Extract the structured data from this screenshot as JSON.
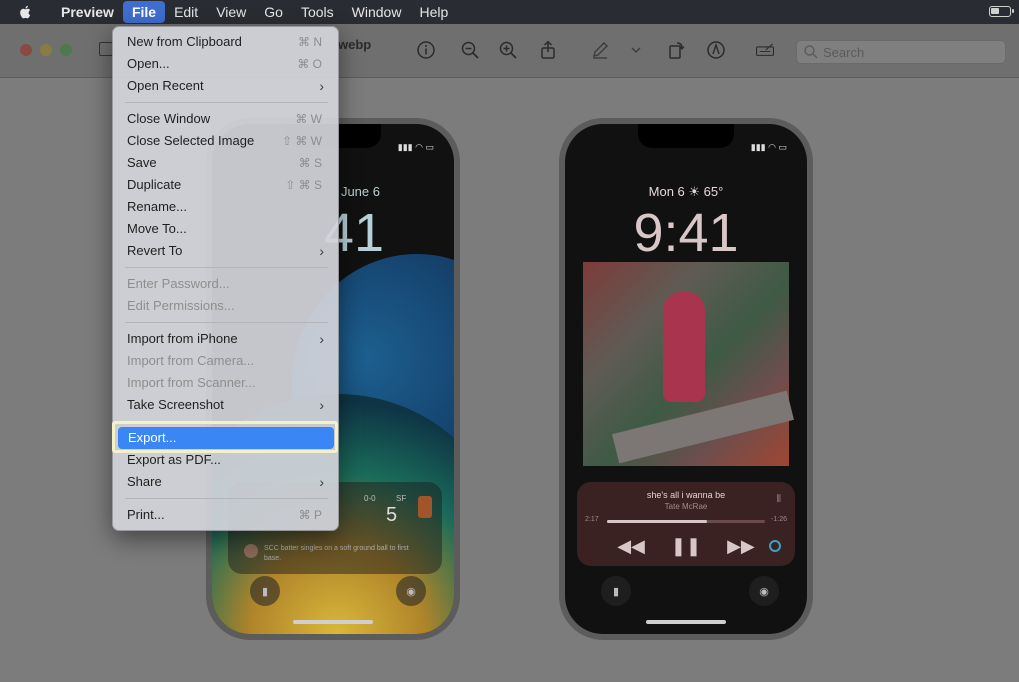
{
  "menubar": {
    "apple_icon": "apple-icon",
    "app": "Preview",
    "items": [
      "File",
      "Edit",
      "View",
      "Go",
      "Tools",
      "Window",
      "Help"
    ],
    "active": "File"
  },
  "window": {
    "title": "webp",
    "search_placeholder": "Search"
  },
  "file_menu": {
    "items": [
      {
        "label": "New from Clipboard",
        "shortcut": "⌘ N"
      },
      {
        "label": "Open...",
        "shortcut": "⌘ O"
      },
      {
        "label": "Open Recent",
        "submenu": "›"
      },
      {
        "label": "Close Window",
        "shortcut": "⌘ W"
      },
      {
        "label": "Close Selected Image",
        "shortcut": "⇧ ⌘ W"
      },
      {
        "label": "Save",
        "shortcut": "⌘ S"
      },
      {
        "label": "Duplicate",
        "shortcut": "⇧ ⌘ S"
      },
      {
        "label": "Rename..."
      },
      {
        "label": "Move To..."
      },
      {
        "label": "Revert To",
        "submenu": "›"
      },
      {
        "label": "Enter Password...",
        "disabled": true
      },
      {
        "label": "Edit Permissions...",
        "disabled": true
      },
      {
        "label": "Import from iPhone",
        "submenu": "›"
      },
      {
        "label": "Import from Camera...",
        "disabled": true
      },
      {
        "label": "Import from Scanner...",
        "disabled": true
      },
      {
        "label": "Take Screenshot",
        "submenu": "›"
      },
      {
        "label": "Export...",
        "highlighted": true
      },
      {
        "label": "Export as PDF..."
      },
      {
        "label": "Share",
        "submenu": "›"
      },
      {
        "label": "Print...",
        "shortcut": "⌘ P"
      }
    ]
  },
  "phone_left": {
    "date": "June 6",
    "time": "41",
    "widget_score": "0-0",
    "widget_team": "SF",
    "widget_big": "5",
    "news": "SCC batter singles on a soft ground ball to first base."
  },
  "phone_right": {
    "date": "Mon 6 ☀ 65°",
    "time": "9:41",
    "song": "she's all i wanna be",
    "artist": "Tate McRae",
    "elapsed": "2:17",
    "remaining": "-1:26",
    "progress": 0.63
  },
  "colors": {
    "menu_highlight": "#3a86f4",
    "highlight_frame": "#f6f0c8"
  }
}
